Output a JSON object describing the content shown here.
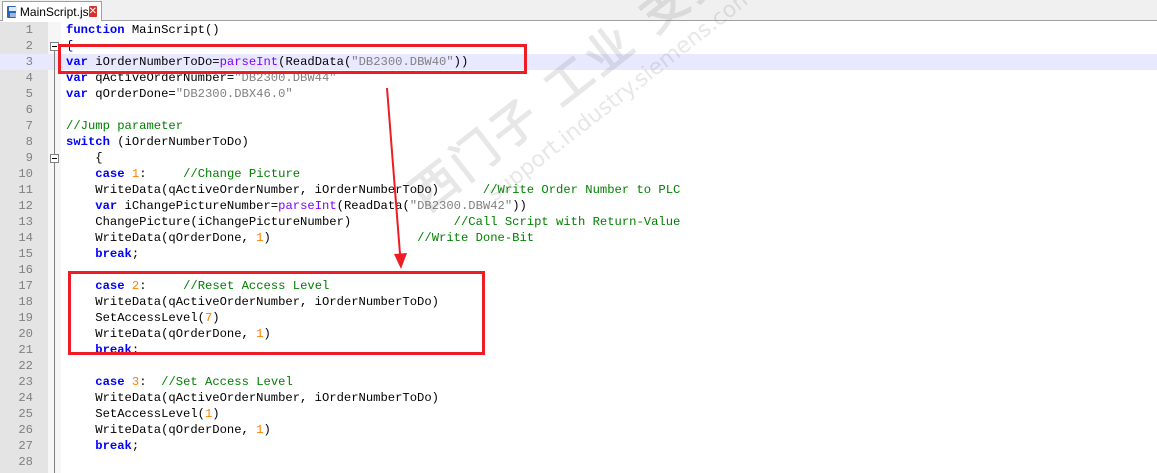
{
  "tab": {
    "title": "MainScript.js",
    "icon": "save-icon",
    "close_icon": "close-icon"
  },
  "editor": {
    "current_line": 3,
    "lines": [
      {
        "n": "1",
        "tokens": [
          {
            "c": "kw",
            "t": "function"
          },
          {
            "c": "id",
            "t": " MainScript()"
          }
        ]
      },
      {
        "n": "2",
        "tokens": [
          {
            "c": "op",
            "t": "{"
          }
        ]
      },
      {
        "n": "3",
        "tokens": [
          {
            "c": "kw",
            "t": "var"
          },
          {
            "c": "id",
            "t": " iOrderNumberToDo="
          },
          {
            "c": "fn",
            "t": "parseInt"
          },
          {
            "c": "id",
            "t": "(ReadData("
          },
          {
            "c": "str",
            "t": "\"DB2300.DBW40\""
          },
          {
            "c": "id",
            "t": "))"
          }
        ]
      },
      {
        "n": "4",
        "tokens": [
          {
            "c": "kw",
            "t": "var"
          },
          {
            "c": "id",
            "t": " qActiveOrderNumber="
          },
          {
            "c": "str",
            "t": "\"DB2300.DBW44\""
          }
        ]
      },
      {
        "n": "5",
        "tokens": [
          {
            "c": "kw",
            "t": "var"
          },
          {
            "c": "id",
            "t": " qOrderDone="
          },
          {
            "c": "str",
            "t": "\"DB2300.DBX46.0\""
          }
        ]
      },
      {
        "n": "6",
        "tokens": []
      },
      {
        "n": "7",
        "tokens": [
          {
            "c": "cm",
            "t": "//Jump parameter"
          }
        ]
      },
      {
        "n": "8",
        "tokens": [
          {
            "c": "kw",
            "t": "switch"
          },
          {
            "c": "id",
            "t": " (iOrderNumberToDo)"
          }
        ]
      },
      {
        "n": "9",
        "tokens": [
          {
            "c": "id",
            "t": "    {"
          }
        ]
      },
      {
        "n": "10",
        "tokens": [
          {
            "c": "id",
            "t": "    "
          },
          {
            "c": "kw",
            "t": "case"
          },
          {
            "c": "id",
            "t": " "
          },
          {
            "c": "num",
            "t": "1"
          },
          {
            "c": "id",
            "t": ":     "
          },
          {
            "c": "cm",
            "t": "//Change Picture"
          }
        ]
      },
      {
        "n": "11",
        "tokens": [
          {
            "c": "id",
            "t": "    WriteData(qActiveOrderNumber, iOrderNumberToDo)      "
          },
          {
            "c": "cm",
            "t": "//Write Order Number to PLC"
          }
        ]
      },
      {
        "n": "12",
        "tokens": [
          {
            "c": "id",
            "t": "    "
          },
          {
            "c": "kw",
            "t": "var"
          },
          {
            "c": "id",
            "t": " iChangePictureNumber="
          },
          {
            "c": "fn",
            "t": "parseInt"
          },
          {
            "c": "id",
            "t": "(ReadData("
          },
          {
            "c": "str",
            "t": "\"DB2300.DBW42\""
          },
          {
            "c": "id",
            "t": "))"
          }
        ]
      },
      {
        "n": "13",
        "tokens": [
          {
            "c": "id",
            "t": "    ChangePicture(iChangePictureNumber)              "
          },
          {
            "c": "cm",
            "t": "//Call Script with Return-Value"
          }
        ]
      },
      {
        "n": "14",
        "tokens": [
          {
            "c": "id",
            "t": "    WriteData(qOrderDone, "
          },
          {
            "c": "num",
            "t": "1"
          },
          {
            "c": "id",
            "t": ")                    "
          },
          {
            "c": "cm",
            "t": "//Write Done-Bit"
          }
        ]
      },
      {
        "n": "15",
        "tokens": [
          {
            "c": "id",
            "t": "    "
          },
          {
            "c": "kw",
            "t": "break"
          },
          {
            "c": "id",
            "t": ";"
          }
        ]
      },
      {
        "n": "16",
        "tokens": []
      },
      {
        "n": "17",
        "tokens": [
          {
            "c": "id",
            "t": "    "
          },
          {
            "c": "kw",
            "t": "case"
          },
          {
            "c": "id",
            "t": " "
          },
          {
            "c": "num",
            "t": "2"
          },
          {
            "c": "id",
            "t": ":     "
          },
          {
            "c": "cm",
            "t": "//Reset Access Level"
          }
        ]
      },
      {
        "n": "18",
        "tokens": [
          {
            "c": "id",
            "t": "    WriteData(qActiveOrderNumber, iOrderNumberToDo)"
          }
        ]
      },
      {
        "n": "19",
        "tokens": [
          {
            "c": "id",
            "t": "    SetAccessLevel("
          },
          {
            "c": "num",
            "t": "7"
          },
          {
            "c": "id",
            "t": ")"
          }
        ]
      },
      {
        "n": "20",
        "tokens": [
          {
            "c": "id",
            "t": "    WriteData(qOrderDone, "
          },
          {
            "c": "num",
            "t": "1"
          },
          {
            "c": "id",
            "t": ")"
          }
        ]
      },
      {
        "n": "21",
        "tokens": [
          {
            "c": "id",
            "t": "    "
          },
          {
            "c": "kw",
            "t": "break"
          },
          {
            "c": "id",
            "t": ";"
          }
        ]
      },
      {
        "n": "22",
        "tokens": []
      },
      {
        "n": "23",
        "tokens": [
          {
            "c": "id",
            "t": "    "
          },
          {
            "c": "kw",
            "t": "case"
          },
          {
            "c": "id",
            "t": " "
          },
          {
            "c": "num",
            "t": "3"
          },
          {
            "c": "id",
            "t": ":  "
          },
          {
            "c": "cm",
            "t": "//Set Access Level"
          }
        ]
      },
      {
        "n": "24",
        "tokens": [
          {
            "c": "id",
            "t": "    WriteData(qActiveOrderNumber, iOrderNumberToDo)"
          }
        ]
      },
      {
        "n": "25",
        "tokens": [
          {
            "c": "id",
            "t": "    SetAccessLevel("
          },
          {
            "c": "num",
            "t": "1"
          },
          {
            "c": "id",
            "t": ")"
          }
        ]
      },
      {
        "n": "26",
        "tokens": [
          {
            "c": "id",
            "t": "    WriteData(qOrderDone, "
          },
          {
            "c": "num",
            "t": "1"
          },
          {
            "c": "id",
            "t": ")"
          }
        ]
      },
      {
        "n": "27",
        "tokens": [
          {
            "c": "id",
            "t": "    "
          },
          {
            "c": "kw",
            "t": "break"
          },
          {
            "c": "id",
            "t": ";"
          }
        ]
      },
      {
        "n": "28",
        "tokens": []
      }
    ]
  },
  "watermark": {
    "line1": "西门子 工业 支持论坛",
    "line2": "support.industry.siemens.com/cs"
  },
  "colors": {
    "annotation_red": "#ee1c25",
    "keyword": "#0000ff",
    "comment": "#008000",
    "string": "#808080",
    "number": "#ff8000",
    "builtin": "#8000ff"
  }
}
